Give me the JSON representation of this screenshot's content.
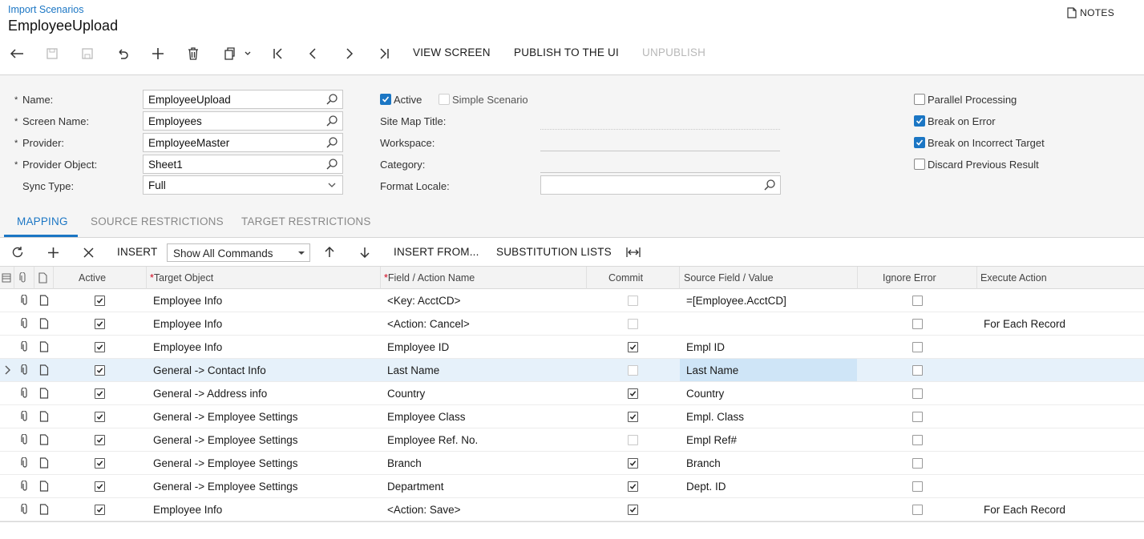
{
  "breadcrumb": "Import Scenarios",
  "page_title": "EmployeeUpload",
  "notes_label": "NOTES",
  "toolbar": {
    "view_screen": "VIEW SCREEN",
    "publish": "PUBLISH TO THE UI",
    "unpublish": "UNPUBLISH"
  },
  "form": {
    "name_label": "Name:",
    "name_value": "EmployeeUpload",
    "screen_name_label": "Screen Name:",
    "screen_name_value": "Employees",
    "provider_label": "Provider:",
    "provider_value": "EmployeeMaster",
    "provider_object_label": "Provider Object:",
    "provider_object_value": "Sheet1",
    "sync_type_label": "Sync Type:",
    "sync_type_value": "Full",
    "active_label": "Active",
    "active_checked": true,
    "simple_label": "Simple Scenario",
    "simple_checked": false,
    "site_map_label": "Site Map Title:",
    "workspace_label": "Workspace:",
    "category_label": "Category:",
    "format_locale_label": "Format Locale:",
    "format_locale_value": "",
    "parallel_label": "Parallel Processing",
    "parallel_checked": false,
    "break_error_label": "Break on Error",
    "break_error_checked": true,
    "break_target_label": "Break on Incorrect Target",
    "break_target_checked": true,
    "discard_label": "Discard Previous Result",
    "discard_checked": false
  },
  "tabs": [
    "MAPPING",
    "SOURCE RESTRICTIONS",
    "TARGET RESTRICTIONS"
  ],
  "grid_toolbar": {
    "insert": "INSERT",
    "command_filter": "Show All Commands",
    "insert_from": "INSERT FROM...",
    "substitution": "SUBSTITUTION LISTS"
  },
  "columns": {
    "active": "Active",
    "target": "Target Object",
    "field": "Field / Action Name",
    "commit": "Commit",
    "source": "Source Field / Value",
    "ignore": "Ignore Error",
    "execute": "Execute Action"
  },
  "rows": [
    {
      "target": "Employee Info",
      "field": "<Key: AcctCD>",
      "commit": false,
      "source": "=[Employee.AcctCD]",
      "execute": ""
    },
    {
      "target": "Employee Info",
      "field": "<Action: Cancel>",
      "commit": false,
      "source": "",
      "execute": "For Each Record"
    },
    {
      "target": "Employee Info",
      "field": "Employee ID",
      "commit": true,
      "source": "Empl ID",
      "execute": ""
    },
    {
      "target": "General -> Contact Info",
      "field": "Last Name",
      "commit": false,
      "source": "Last Name",
      "execute": ""
    },
    {
      "target": "General -> Address info",
      "field": "Country",
      "commit": true,
      "source": "Country",
      "execute": ""
    },
    {
      "target": "General -> Employee Settings",
      "field": "Employee Class",
      "commit": true,
      "source": "Empl. Class",
      "execute": ""
    },
    {
      "target": "General -> Employee Settings",
      "field": "Employee Ref. No.",
      "commit": false,
      "source": "Empl Ref#",
      "execute": ""
    },
    {
      "target": "General -> Employee Settings",
      "field": "Branch",
      "commit": true,
      "source": "Branch",
      "execute": ""
    },
    {
      "target": "General -> Employee Settings",
      "field": "Department",
      "commit": true,
      "source": "Dept. ID",
      "execute": ""
    },
    {
      "target": "Employee Info",
      "field": "<Action: Save>",
      "commit": true,
      "source": "",
      "execute": "For Each Record"
    }
  ],
  "selected_row": 3
}
